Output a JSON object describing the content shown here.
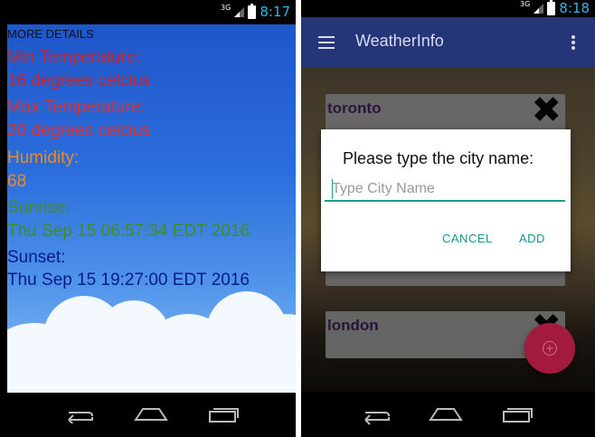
{
  "left_screen": {
    "status": {
      "network": "3G",
      "time": "8:17"
    },
    "heading": "MORE DETAILS",
    "details": [
      {
        "label": "Min Temperature:",
        "value": "16 degrees celcius",
        "color": "#cc2222"
      },
      {
        "label": "Max Temperature:",
        "value": "20 degrees celcius",
        "color": "#dd3030"
      },
      {
        "label": "Humidity:",
        "value": "68",
        "color": "#ef8b17"
      },
      {
        "label": "Sunrise:",
        "value": "Thu Sep 15 06:57:34 EDT 2016",
        "color": "#3f8f1b"
      },
      {
        "label": "Sunset:",
        "value": "Thu Sep 15 19:27:00 EDT 2016",
        "color": "#0a1a8c"
      }
    ],
    "nav_icons": [
      "back-icon",
      "home-icon",
      "recents-icon"
    ]
  },
  "right_screen": {
    "status": {
      "network": "3G",
      "time": "8:18"
    },
    "toolbar": {
      "title": "WeatherInfo",
      "menu_icon": "hamburger-icon",
      "overflow_icon": "overflow-menu-icon"
    },
    "cities": [
      {
        "name": "toronto"
      },
      {
        "name": ""
      },
      {
        "name": "london"
      }
    ],
    "dialog": {
      "title": "Please type the city name:",
      "placeholder": "Type City Name",
      "value": "",
      "cancel_label": "CANCEL",
      "add_label": "ADD"
    },
    "fab_icon": "add-icon",
    "accent_color": "#139e91",
    "toolbar_color": "#253678",
    "fab_color": "#a21b3f",
    "nav_icons": [
      "back-icon",
      "home-icon",
      "recents-icon"
    ]
  }
}
